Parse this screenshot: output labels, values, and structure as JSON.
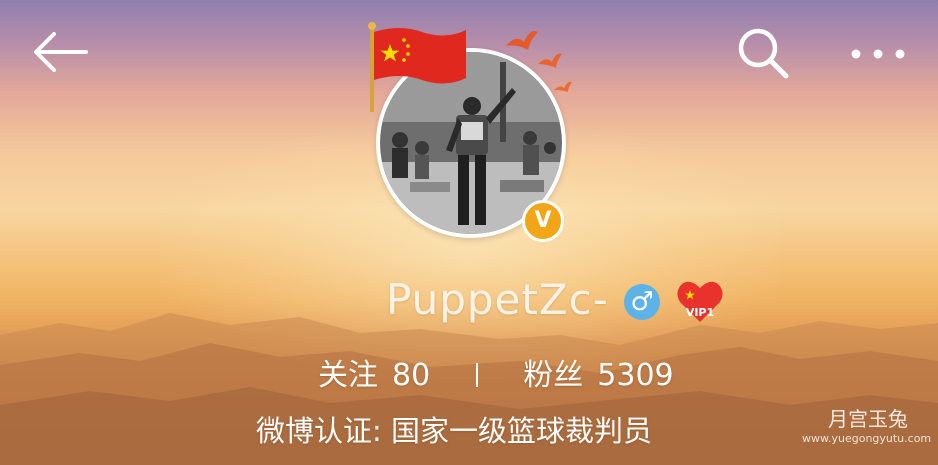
{
  "header": {
    "back_icon": "arrow-left-icon",
    "search_icon": "search-icon",
    "more_icon": "more-dots-icon"
  },
  "profile": {
    "username": "PuppetZc-",
    "gender_symbol": "♂",
    "gender_icon": "male-icon",
    "verified_mark": "V",
    "vip_label": "VIP1",
    "avatar_decoration": "china-flag-icon"
  },
  "stats": {
    "following_label": "关注",
    "following_count": "80",
    "followers_label": "粉丝",
    "followers_count": "5309"
  },
  "verification": {
    "text": "微博认证: 国家一级篮球裁判员"
  },
  "watermark": {
    "title": "月宫玉兔",
    "url": "www.yuegongyutu.com"
  },
  "colors": {
    "gender_badge": "#5db3e8",
    "verified_badge": "#f2a516",
    "vip_heart": "#e8322b",
    "text": "#ffffff"
  }
}
